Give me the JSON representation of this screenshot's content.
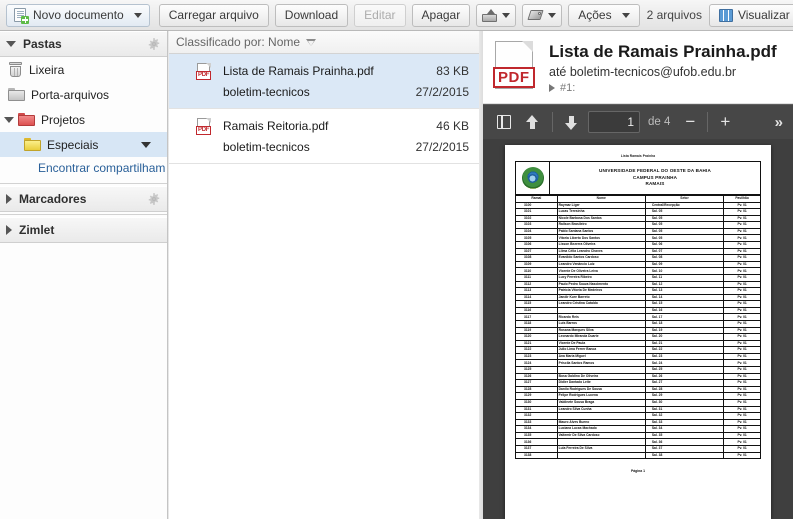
{
  "toolbar": {
    "new_document": "Novo documento",
    "upload": "Carregar arquivo",
    "download": "Download",
    "edit": "Editar",
    "delete": "Apagar",
    "actions": "Ações",
    "file_count": "2 arquivos",
    "view": "Visualizar",
    "icons": {
      "new_doc": "new-document-icon",
      "move": "move-to-folder-icon",
      "tag": "tag-icon",
      "columns": "columns-view-icon"
    }
  },
  "sidebar": {
    "sections": [
      {
        "label": "Pastas",
        "expanded": true,
        "has_gear": true
      },
      {
        "label": "Marcadores",
        "expanded": false,
        "has_gear": true
      },
      {
        "label": "Zimlet",
        "expanded": false,
        "has_gear": false
      }
    ],
    "folders": [
      {
        "label": "Lixeira",
        "icon": "trash-icon",
        "indent": 1,
        "selected": false,
        "twisty": "none"
      },
      {
        "label": "Porta-arquivos",
        "icon": "folder-grey-icon",
        "indent": 1,
        "selected": false,
        "twisty": "none"
      },
      {
        "label": "Projetos",
        "icon": "folder-red-icon",
        "indent": 1,
        "selected": false,
        "twisty": "down"
      },
      {
        "label": "Especiais",
        "icon": "folder-yellow-icon",
        "indent": 2,
        "selected": true,
        "twisty": "none"
      }
    ],
    "share_link": "Encontrar compartilham"
  },
  "filelist": {
    "sort_label": "Classificado por: Nome",
    "rows": [
      {
        "name": "Lista de Ramais Prainha.pdf",
        "size": "83 KB",
        "owner": "boletim-tecnicos",
        "date": "27/2/2015",
        "selected": true,
        "icon": "pdf-icon"
      },
      {
        "name": "Ramais Reitoria.pdf",
        "size": "46 KB",
        "owner": "boletim-tecnicos",
        "date": "27/2/2015",
        "selected": false,
        "icon": "pdf-icon"
      }
    ]
  },
  "preview": {
    "title": "Lista de Ramais Prainha.pdf",
    "subtitle": "até boletim-tecnicos@ufob.edu.br",
    "version": "#1:",
    "pdf_toolbar": {
      "sidebar_toggle": "sidebar-toggle-icon",
      "prev_page": "arrow-up-icon",
      "next_page": "arrow-down-icon",
      "page_number": "1",
      "page_total": "de 4",
      "zoom_out": "−",
      "zoom_in": "+",
      "more": "»"
    },
    "document": {
      "top_title": "Lista Ramais Prainha",
      "header_line1": "UNIVERSIDADE FEDERAL DO OESTE DA BAHIA",
      "header_line2": "CAMPUS PRAINHA",
      "header_line3": "RAMAIS",
      "crest": "brazil-coat-of-arms",
      "columns": [
        "Ramal",
        "Nome",
        "Setor",
        "Pavilhão"
      ],
      "rows": [
        [
          "3100",
          "Raymar Liger",
          "Central/Recepção",
          "Pv. 01"
        ],
        [
          "3101",
          "Lucas Teresinha",
          "Sal. 05",
          "Pv. 01"
        ],
        [
          "3102",
          "Nicole Barbosa Dos Santos",
          "Sal. 05",
          "Pv. 01"
        ],
        [
          "3103",
          "Railson Brasileiro",
          "Sal. 05",
          "Pv. 01"
        ],
        [
          "3104",
          "Pablo Santana Santos",
          "Sal. 05",
          "Pv. 01"
        ],
        [
          "3105",
          "Vitoria Liberto Dos Santos",
          "Sal. 05",
          "Pv. 01"
        ],
        [
          "3106",
          "Lisson Bezerra Oliveira",
          "Sal. 06",
          "Pv. 01"
        ],
        [
          "3107",
          "Lilma Célia Leandro Chaves",
          "Sal. 07",
          "Pv. 01"
        ],
        [
          "3108",
          "Evanildo Santos Cardoso",
          "Sal. 08",
          "Pv. 01"
        ],
        [
          "3109",
          "Leandro Venâncio Luiz",
          "Sal. 09",
          "Pv. 01"
        ],
        [
          "3110",
          "Vicente De Oliveira Leiva",
          "Sal. 10",
          "Pv. 01"
        ],
        [
          "3111",
          "Lucy Ferreira Ribeiro",
          "Sal. 11",
          "Pv. 01"
        ],
        [
          "3112",
          "Paulo Pedro Souza Nascimento",
          "Sal. 12",
          "Pv. 01"
        ],
        [
          "3113",
          "Patrícia Vitoria De Medeiros",
          "Sal. 13",
          "Pv. 01"
        ],
        [
          "3114",
          "Jandir Kure Barreto",
          "Sal. 14",
          "Pv. 01"
        ],
        [
          "3115",
          "Leandro Cristina Cataldo",
          "Sal. 15",
          "Pv. 01"
        ],
        [
          "3116",
          "",
          "Sal. 16",
          "Pv. 01"
        ],
        [
          "3117",
          "Ricardo Reis",
          "Sal. 17",
          "Pv. 01"
        ],
        [
          "3118",
          "Luis Barros",
          "Sal. 18",
          "Pv. 01"
        ],
        [
          "3119",
          "Rosana Marques Silva",
          "Sal. 19",
          "Pv. 01"
        ],
        [
          "3120",
          "Leonardo Miranda Duarte",
          "Sal. 20",
          "Pv. 01"
        ],
        [
          "3121",
          "Vicente De Paula",
          "Sal. 21",
          "Pv. 01"
        ],
        [
          "3122",
          "Julio Lima Ferrer Banca",
          "Sal. 22",
          "Pv. 01"
        ],
        [
          "3123",
          "Ana Maria Miguel",
          "Sal. 23",
          "Pv. 01"
        ],
        [
          "3124",
          "Priscila Santos Ramos",
          "Sal. 24",
          "Pv. 01"
        ],
        [
          "3125",
          "",
          "Sal. 25",
          "Pv. 01"
        ],
        [
          "3126",
          "Bosa Galdino De Oliveira",
          "Sal. 26",
          "Pv. 01"
        ],
        [
          "3127",
          "Didier Dantado Leite",
          "Sal. 27",
          "Pv. 01"
        ],
        [
          "3128",
          "Danilo Rodrigues De Sousa",
          "Sal. 28",
          "Pv. 01"
        ],
        [
          "3129",
          "Felipe Rodrigues Lucena",
          "Sal. 29",
          "Pv. 01"
        ],
        [
          "3130",
          "Valdinete Sousa Braga",
          "Sal. 30",
          "Pv. 01"
        ],
        [
          "3131",
          "Leandro Silva Cunha",
          "Sal. 31",
          "Pv. 01"
        ],
        [
          "3132",
          "",
          "Sal. 32",
          "Pv. 01"
        ],
        [
          "3133",
          "Mauro Alves Bueno",
          "Sal. 33",
          "Pv. 01"
        ],
        [
          "3134",
          "Luciana Lucas Machado",
          "Sal. 34",
          "Pv. 01"
        ],
        [
          "3135",
          "Valtemir De Silva Cardoso",
          "Sal. 35",
          "Pv. 01"
        ],
        [
          "3136",
          "",
          "Sal. 36",
          "Pv. 01"
        ],
        [
          "3137",
          "Lula Ferreira De Silva",
          "Sal. 37",
          "Pv. 01"
        ],
        [
          "3138",
          "",
          "Sal. 38",
          "Pv. 01"
        ]
      ],
      "footer": "Página 1"
    }
  }
}
